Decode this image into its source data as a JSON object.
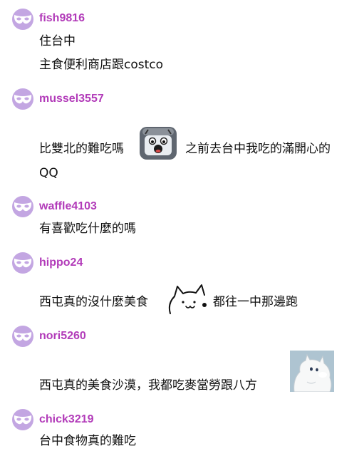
{
  "comments": [
    {
      "user": "fish9816",
      "lines": [
        "住台中",
        "主食便利商店跟costco"
      ]
    },
    {
      "user": "mussel3557",
      "text_before_sticker": "比雙北的難吃嗎",
      "sticker": "shocked-toaster-sticker",
      "text_after_sticker": "之前去台中我吃的滿開心的",
      "line2": "QQ"
    },
    {
      "user": "waffle4103",
      "lines": [
        "有喜歡吃什麼的嗎"
      ]
    },
    {
      "user": "hippo24",
      "text_before_sticker": "西屯真的沒什麼美食",
      "sticker": "doodle-cat-sticker",
      "text_after_sticker": "都往一中那邊跑"
    },
    {
      "user": "nori5260",
      "text": "西屯真的美食沙漠，我都吃麥當勞跟八方",
      "sticker": "moomin-sticker"
    },
    {
      "user": "chick3219",
      "lines": [
        "台中食物真的難吃"
      ]
    }
  ],
  "colors": {
    "username": "#b23bb9",
    "avatar_bg": "#c3a6e2",
    "text": "#111111"
  },
  "avatar_icon": "mask-icon"
}
